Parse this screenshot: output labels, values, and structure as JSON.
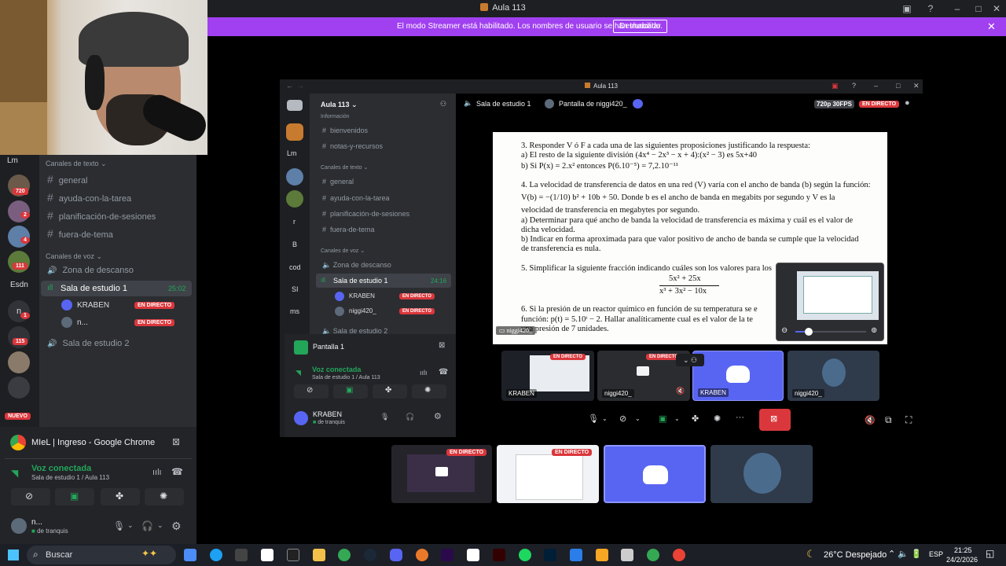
{
  "window": {
    "title": "Aula 113"
  },
  "banner": {
    "message": "El modo Streamer está habilitado. Los nombres de usuario se han truncado.",
    "button": "Deshabilitar"
  },
  "sidebar": {
    "server_short": "Lm",
    "text_category": "Canales de texto",
    "text_channels": [
      "general",
      "ayuda-con-la-tarea",
      "planificación-de-sesiones",
      "fuera-de-tema"
    ],
    "voice_category": "Canales de voz",
    "voice_channels": [
      "Zona de descanso",
      "Sala de estudio 1",
      "Sala de estudio 2"
    ],
    "active_timer": "25:02",
    "members": [
      {
        "name": "KRABEN",
        "badge": "EN DIRECTO"
      },
      {
        "name": "n...",
        "badge": "EN DIRECTO"
      }
    ],
    "server_badges": [
      "720",
      "2",
      "4",
      "111",
      "1",
      "115"
    ],
    "server_labels": [
      "Esdn",
      "n"
    ],
    "new_label": "NUEVO"
  },
  "voice_panel": {
    "stream_title": "MIeL | Ingreso - Google Chrome",
    "status": "Voz conectada",
    "location": "Sala de estudio 1 / Aula 113",
    "user": "n...",
    "user_status": "de tranquis"
  },
  "inner": {
    "title": "Aula 113",
    "server_name": "Aula 113",
    "info_category": "Información",
    "info_channels": [
      "bienvenidos",
      "notas-y-recursos"
    ],
    "text_category": "Canales de texto",
    "text_channels": [
      "general",
      "ayuda-con-la-tarea",
      "planificación-de-sesiones",
      "fuera-de-tema"
    ],
    "voice_category": "Canales de voz",
    "voice_channels": [
      "Zona de descanso",
      "Sala de estudio 1",
      "Sala de estudio 2"
    ],
    "timer": "24:16",
    "members": [
      {
        "name": "KRABEN",
        "badge": "EN DIRECTO"
      },
      {
        "name": "niggi420_",
        "badge": "EN DIRECTO"
      }
    ],
    "server_labels": [
      "Lm",
      "r",
      "B",
      "cod",
      "SI",
      "ms"
    ],
    "header_channel": "Sala de estudio 1",
    "header_screen": "Pantalla de niggi420_",
    "quality": "720p 30FPS",
    "live_badge": "EN DIRECTO",
    "panel_title": "Pantalla 1",
    "voice_status": "Voz conectada",
    "voice_location": "Sala de estudio 1 / Aula 113",
    "user": "KRABEN",
    "user_status": "de tranquis",
    "stream_label": "niggi420_",
    "tiles": [
      {
        "label": "KRABEN",
        "badge": "EN DIRECTO"
      },
      {
        "label": "niggi420_",
        "badge": "EN DIRECTO"
      },
      {
        "label": "KRABEN",
        "badge": ""
      },
      {
        "label": "niggi420_",
        "badge": ""
      }
    ]
  },
  "document": {
    "lines": [
      "3.   Responder V ó F a cada una de las siguientes proposiciones justificando la respuesta:",
      "a) El resto de la siguiente división (4x⁴ − 2x³ − x + 4):(x² − 3) es 5x+40",
      "b) Si P(x) = 2.x² entonces P(6.10⁻⁵) = 7,2.10⁻¹¹",
      "4.   La velocidad de transferencia de datos en una red (V) varía con el ancho de banda (b) según la función:",
      "V(b) = −(1/10) b² + 10b + 50. Donde b es el ancho de banda en megabits por segundo y V es la",
      "velocidad de transferencia en megabytes por segundo.",
      "a) Determinar para qué ancho de banda la velocidad de transferencia es máxima y cuál es el valor de",
      "dicha velocidad.",
      "b) Indicar en forma aproximada para que valor positivo de ancho de banda se cumple que la velocidad",
      "de transferencia es nula.",
      "5.   Simplificar la siguiente fracción indicando cuáles son los valores para los",
      "5x² + 25x",
      "x³ + 3x² − 10x",
      "6.   Si la presión de un reactor químico en función de su temperatura se e",
      "función: p(t) = 5.10ᵗ − 2. Hallar analíticamente cual es el valor de la te",
      "una presión de 7 unidades."
    ]
  },
  "bottom_tiles": [
    {
      "badge": "EN DIRECTO"
    },
    {
      "badge": "EN DIRECTO"
    }
  ],
  "taskbar": {
    "search_placeholder": "Buscar",
    "weather": "26°C  Despejado",
    "lang": "ESP",
    "time": "21:25",
    "date": "24/2/2026"
  },
  "colors": {
    "accent": "#5865f2",
    "live": "#da373c",
    "banner": "#a040f0",
    "green": "#23a55a"
  }
}
